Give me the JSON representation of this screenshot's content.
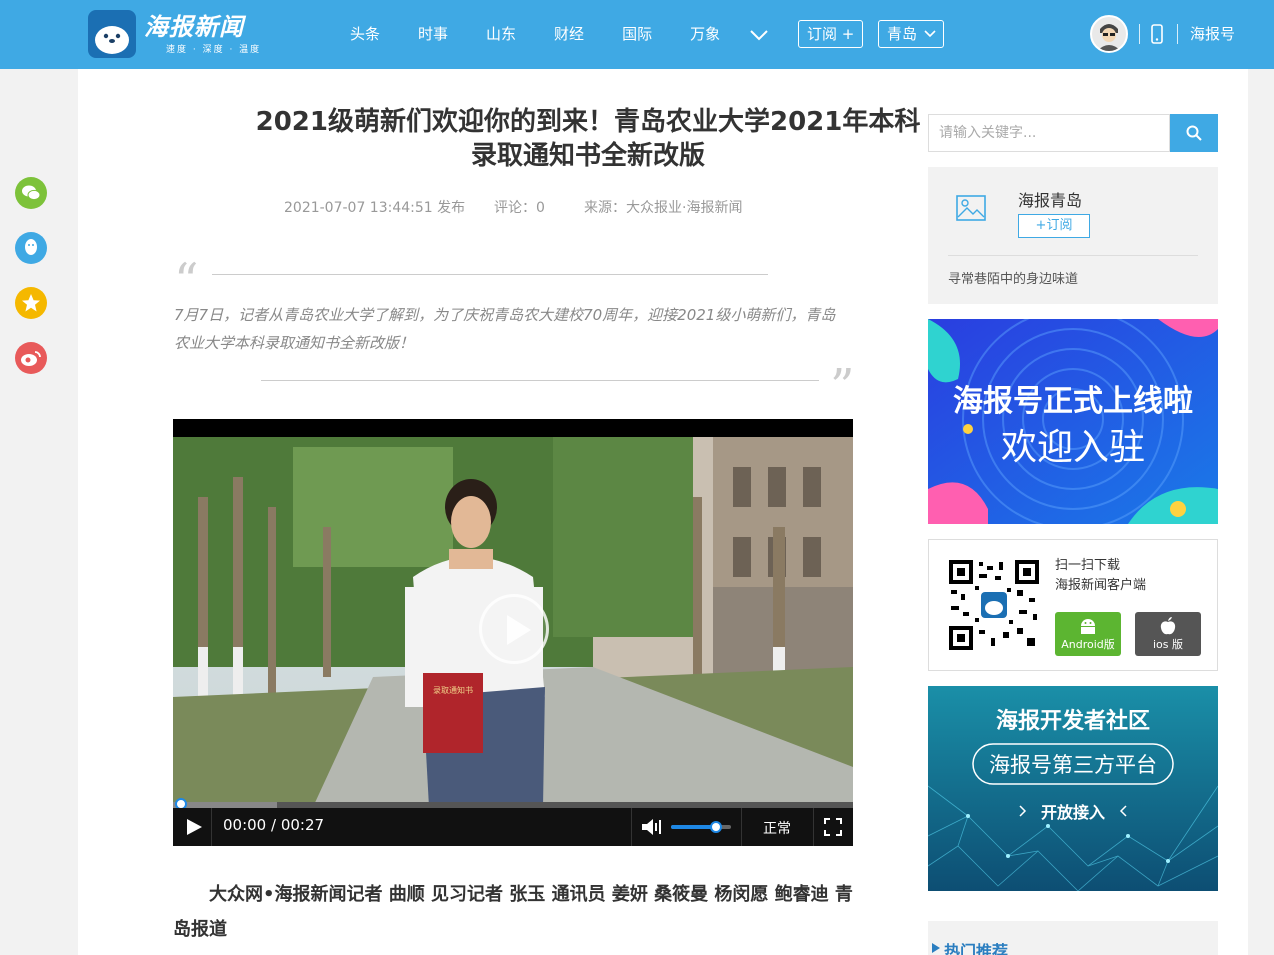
{
  "header": {
    "logo_title": "海报新闻",
    "logo_tagline": "速度 · 深度 · 温度",
    "nav": [
      "头条",
      "时事",
      "山东",
      "财经",
      "国际",
      "万象"
    ],
    "subscribe_label": "订阅 +",
    "city_label": "青岛",
    "haibao_label": "海报号",
    "brand_color": "#3fa9e4"
  },
  "article": {
    "title": "2021级萌新们欢迎你的到来！青岛农业大学2021年本科录取通知书全新改版",
    "date": "2021-07-07 13:44:51 发布",
    "comments": "评论：0",
    "source": "来源：大众报业·海报新闻",
    "summary": "7月7日，记者从青岛农业大学了解到，为了庆祝青岛农大建校70周年，迎接2021级小萌新们，青岛农业大学本科录取通知书全新改版！",
    "byline": "大众网•海报新闻记者 曲顺 见习记者 张玉 通讯员 姜妍 桑筱曼 杨闵愿 鲍睿迪 青岛报道"
  },
  "video": {
    "time": "00:00 / 00:27",
    "speed": "正常",
    "progress": 0,
    "volume": 0.75,
    "book_text": "录取通知书"
  },
  "sidebar": {
    "search_placeholder": "请输入关键字...",
    "channel_name": "海报青岛",
    "channel_subscribe": "+订阅",
    "channel_desc": "寻常巷陌中的身边味道",
    "banner1_line1": "海报号正式上线啦",
    "banner1_line2": "欢迎入驻",
    "download_line1": "扫一扫下载",
    "download_line2": "海报新闻客户端",
    "android_label": "Android版",
    "ios_label": "ios 版",
    "banner2_title": "海报开发者社区",
    "banner2_sub": "海报号第三方平台",
    "banner2_cta": "开放接入",
    "hot_label": "热门推荐"
  },
  "share_icons": [
    "wechat-icon",
    "qq-icon",
    "qzone-icon",
    "weibo-icon"
  ]
}
